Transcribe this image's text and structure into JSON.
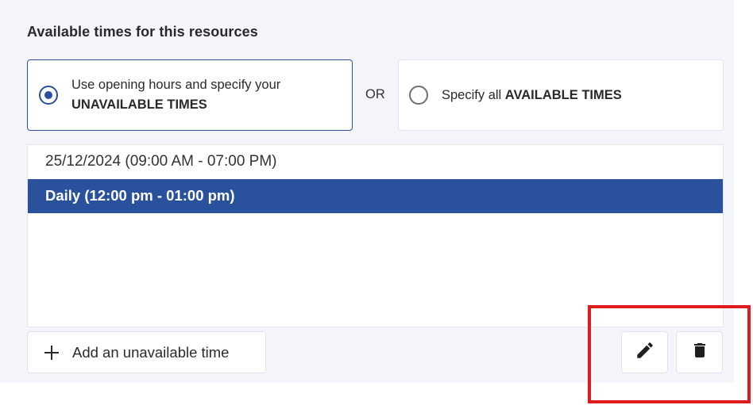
{
  "section": {
    "title": "Available times for this resources"
  },
  "options": {
    "opening_hours": {
      "line1": "Use opening hours and specify your",
      "line2": "UNAVAILABLE TIMES",
      "selected": true
    },
    "or_label": "OR",
    "all_available": {
      "prefix": "Specify all ",
      "bold": "AVAILABLE TIMES",
      "selected": false
    }
  },
  "time_list": {
    "items": [
      {
        "label": "25/12/2024 (09:00 AM - 07:00 PM)",
        "selected": false
      },
      {
        "label": "Daily (12:00 pm - 01:00 pm)",
        "selected": true
      }
    ]
  },
  "actions": {
    "add_label": "Add an unavailable time",
    "add_icon": "plus-icon",
    "edit_icon": "pencil-icon",
    "delete_icon": "trash-icon"
  },
  "colors": {
    "accent": "#29519c",
    "highlight": "#e01b1b",
    "panel_bg": "#f4f5fa"
  }
}
